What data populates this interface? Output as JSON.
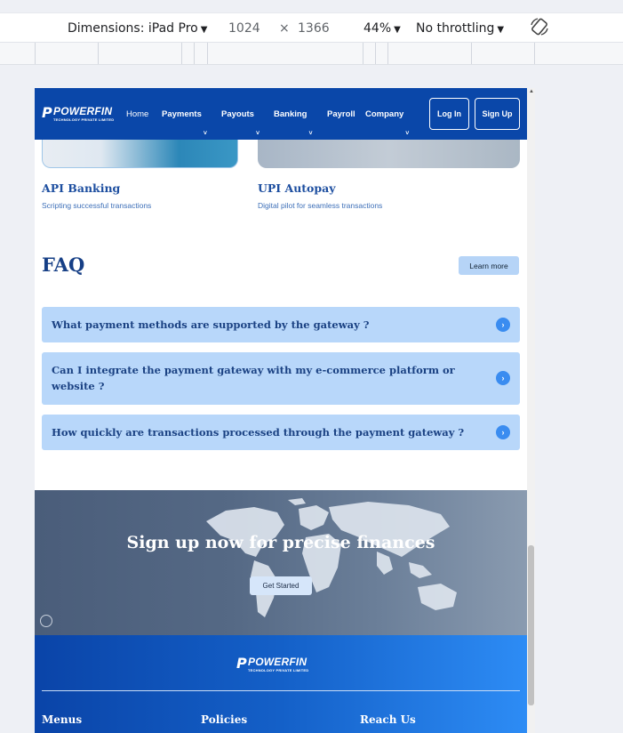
{
  "devtools": {
    "dimensions_label": "Dimensions: iPad Pro",
    "width": "1024",
    "times": "×",
    "height": "1366",
    "zoom": "44%",
    "throttling": "No throttling",
    "caret": "▼",
    "rotate_icon": "rotate-icon"
  },
  "nav": {
    "logo_mark": "P",
    "logo_name": "POWERFIN",
    "logo_sub": "TECHNOLOGY PRIVATE LIMITED",
    "items": [
      "Home",
      "Payments",
      "Payouts",
      "Banking",
      "Payroll",
      "Company"
    ],
    "chevron": "˅",
    "login": "Log In",
    "signup": "Sign Up",
    "colors": {
      "bar": "#0a47a9"
    }
  },
  "cards": [
    {
      "title": "API Banking",
      "subtitle": "Scripting successful transactions"
    },
    {
      "title": "UPI Autopay",
      "subtitle": "Digital pilot for seamless transactions"
    }
  ],
  "faq": {
    "title": "FAQ",
    "learn_more": "Learn more",
    "questions": [
      "What payment methods are supported by the gateway ?",
      "Can I integrate the payment gateway with my e-commerce platform or website ?",
      "How quickly are transactions processed through the payment gateway ?"
    ],
    "arrow": "›"
  },
  "hero": {
    "title": "Sign up now for precise finances",
    "button": "Get Started"
  },
  "footer": {
    "columns": [
      "Menus",
      "Policies",
      "Reach Us"
    ]
  }
}
